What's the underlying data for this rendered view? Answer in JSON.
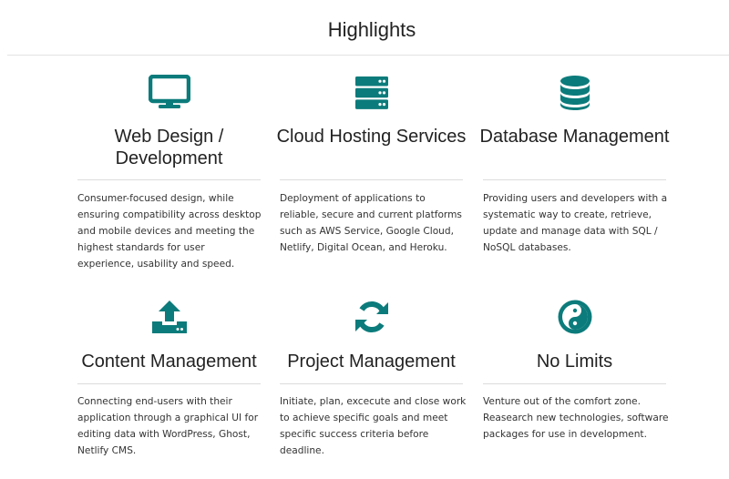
{
  "page": {
    "title": "Highlights"
  },
  "colors": {
    "accent": "#0c7b7b",
    "text": "#222222",
    "muted": "#333333",
    "rule": "#dcdcdc"
  },
  "cards": [
    {
      "icon": "desktop-icon",
      "heading": "Web Design / Development",
      "description": "Consumer-focused design, while ensuring compatibility across desktop and mobile devices and meeting the highest standards for user experience, usability and speed."
    },
    {
      "icon": "server-icon",
      "heading": "Cloud Hosting Services",
      "description": "Deployment of applications to reliable, secure and current platforms such as AWS Service, Google Cloud, Netlify, Digital Ocean, and Heroku."
    },
    {
      "icon": "database-icon",
      "heading": "Database Management",
      "description": "Providing users and developers with a systematic way to create, retrieve, update and manage data with SQL / NoSQL databases."
    },
    {
      "icon": "upload-icon",
      "heading": "Content Management",
      "description": "Connecting end-users with their application through a graphical UI for editing data with WordPress, Ghost, Netlify CMS."
    },
    {
      "icon": "sync-icon",
      "heading": "Project Management",
      "description": "Initiate, plan, excecute and close work to achieve specific goals and meet specific success criteria before deadline."
    },
    {
      "icon": "yin-yang-icon",
      "heading": "No Limits",
      "description": "Venture out of the comfort zone. Reasearch new technologies, software packages for use in development."
    }
  ]
}
